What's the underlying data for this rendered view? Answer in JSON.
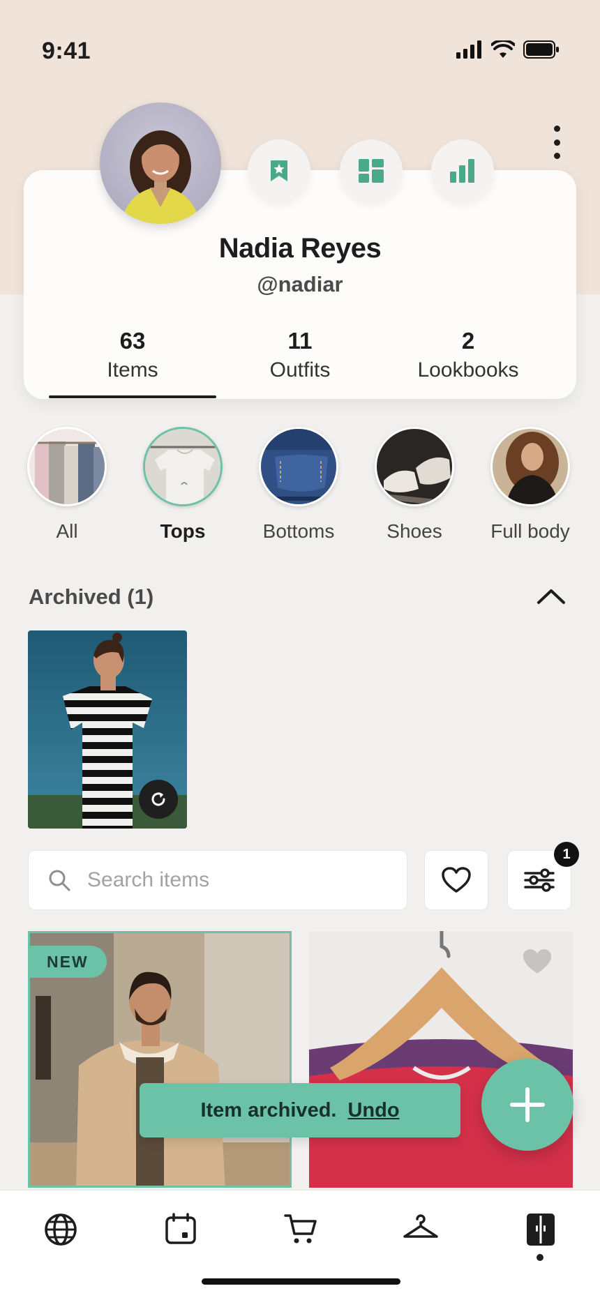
{
  "status_bar": {
    "time": "9:41"
  },
  "profile": {
    "name": "Nadia Reyes",
    "handle": "@nadiar",
    "stats": [
      {
        "count": "63",
        "label": "Items"
      },
      {
        "count": "11",
        "label": "Outfits"
      },
      {
        "count": "2",
        "label": "Lookbooks"
      }
    ],
    "active_stat": "Items"
  },
  "quick_actions": [
    "bookmark-star-icon",
    "dashboard-grid-icon",
    "bar-chart-icon"
  ],
  "categories": [
    {
      "label": "All"
    },
    {
      "label": "Tops"
    },
    {
      "label": "Bottoms"
    },
    {
      "label": "Shoes"
    },
    {
      "label": "Full body"
    }
  ],
  "active_category": "Tops",
  "archived": {
    "title": "Archived (1)"
  },
  "search": {
    "placeholder": "Search items",
    "value": ""
  },
  "filter": {
    "badge": "1"
  },
  "items": [
    {
      "badge": "NEW"
    }
  ],
  "toast": {
    "message": "Item archived.",
    "action": "Undo"
  },
  "colors": {
    "accent": "#6cc2a6",
    "header_bg": "#efe3da",
    "page_bg": "#f1f0ee"
  },
  "bottom_nav": [
    "globe-icon",
    "calendar-icon",
    "cart-icon",
    "hanger-icon",
    "wardrobe-icon"
  ]
}
